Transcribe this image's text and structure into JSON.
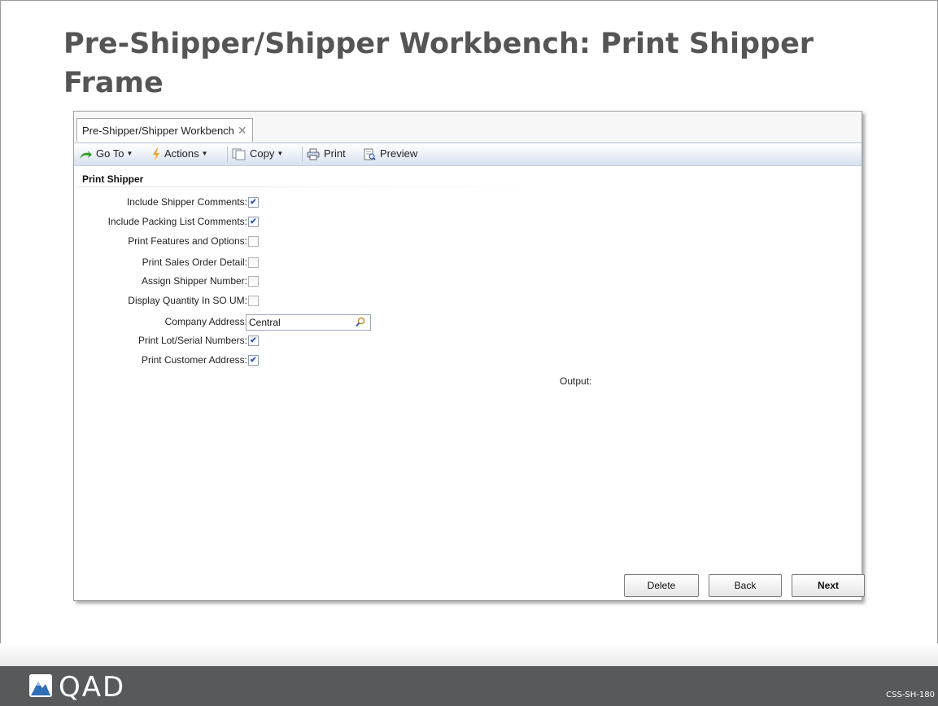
{
  "slide": {
    "title": "Pre-Shipper/Shipper Workbench: Print Shipper Frame",
    "code": "CSS-SH-180",
    "logo_text": "QAD"
  },
  "window": {
    "tab_label": "Pre-Shipper/Shipper Workbench",
    "tab_close": "✕",
    "toolbar": {
      "goto": "Go To",
      "actions": "Actions",
      "copy": "Copy",
      "print": "Print",
      "preview": "Preview"
    },
    "section_title": "Print Shipper",
    "fields": [
      {
        "label": "Include Shipper Comments:",
        "checked": true
      },
      {
        "label": "Include Packing List Comments:",
        "checked": true
      },
      {
        "label": "Print Features and Options:",
        "checked": false
      },
      {
        "label": "Print Sales Order Detail:",
        "checked": false
      },
      {
        "label": "Assign Shipper Number:",
        "checked": false
      },
      {
        "label": "Display Quantity In SO UM:",
        "checked": false
      },
      {
        "label": "Company Address:",
        "value": "Central"
      },
      {
        "label": "Print Lot/Serial Numbers:",
        "checked": true
      },
      {
        "label": "Print Customer Address:",
        "checked": true
      }
    ],
    "output_label": "Output:",
    "buttons": {
      "delete": "Delete",
      "back": "Back",
      "next": "Next"
    },
    "check_glyph": "✔"
  },
  "colors": {
    "footer_bg": "#58595b",
    "title_text": "#555555",
    "accent_blue": "#2b58b5"
  }
}
